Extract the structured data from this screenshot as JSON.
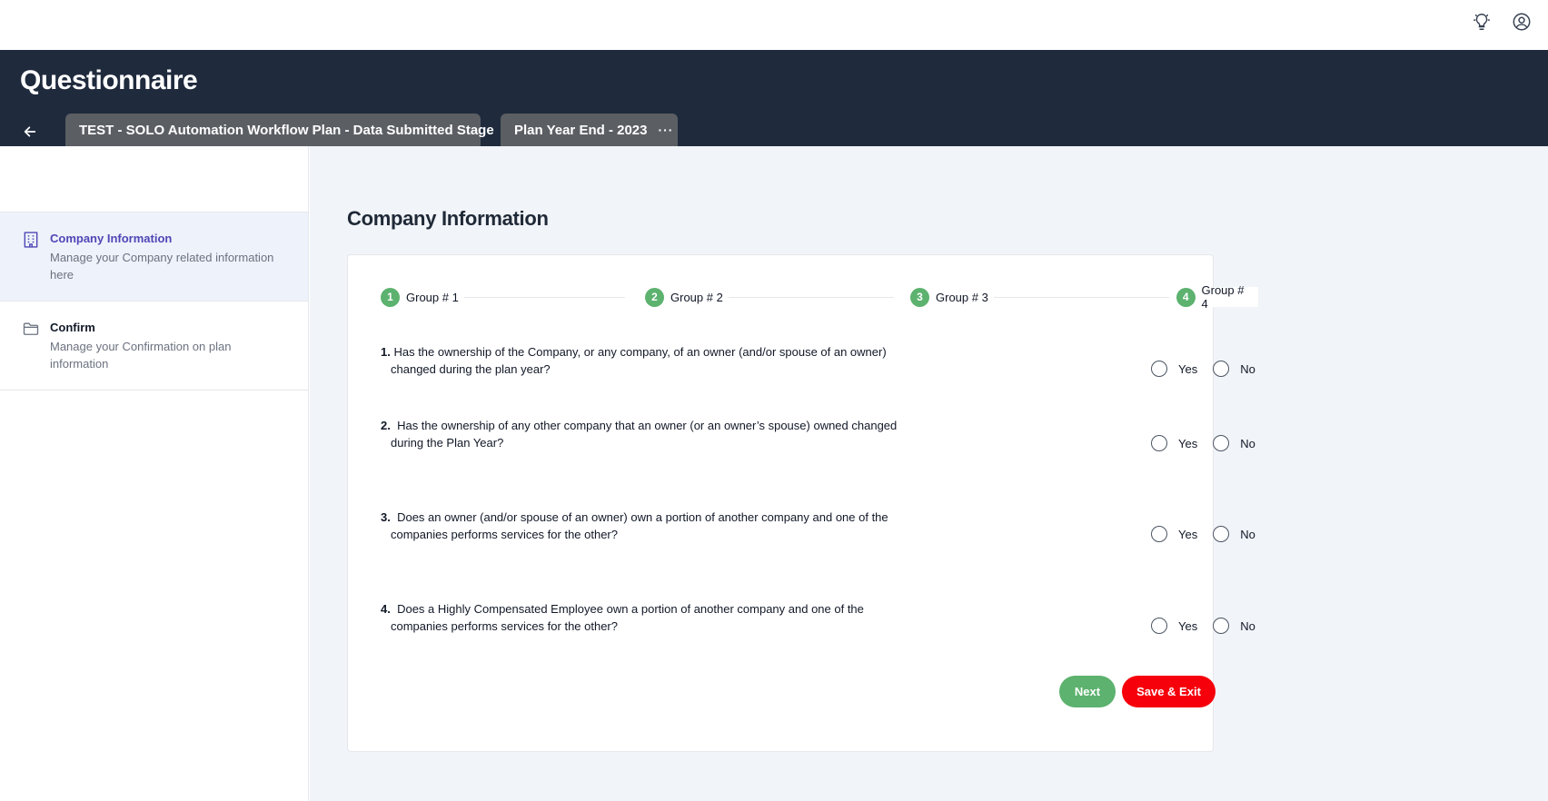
{
  "topbar": {
    "icons": [
      "lightbulb-icon",
      "user-circle-icon"
    ]
  },
  "header": {
    "title": "Questionnaire",
    "tabs": [
      {
        "label": "TEST - SOLO Automation Workflow Plan - Data Submitted Stage"
      },
      {
        "label": "Plan Year End - 2023",
        "more": "···"
      }
    ]
  },
  "sidebar": {
    "items": [
      {
        "title": "Company Information",
        "desc": "Manage your Company related information here",
        "icon": "building-icon",
        "active": true
      },
      {
        "title": "Confirm",
        "desc": "Manage your Confirmation on plan information",
        "icon": "folder-icon",
        "active": false
      }
    ]
  },
  "main": {
    "title": "Company Information",
    "steps": [
      {
        "num": "1",
        "label": "Group # 1"
      },
      {
        "num": "2",
        "label": "Group # 2"
      },
      {
        "num": "3",
        "label": "Group # 3"
      },
      {
        "num": "4",
        "label": "Group # 4"
      }
    ],
    "questions": [
      {
        "num": "1.",
        "text": "Has the ownership of the Company, or any company, of an owner (and/or spouse of an owner) changed during the plan year?"
      },
      {
        "num": "2.",
        "text": "Has the ownership of any other company that an owner (or an owner’s spouse) owned changed during the Plan Year?"
      },
      {
        "num": "3.",
        "text": "Does an owner (and/or spouse of an owner) own a portion of another company and one of the companies performs services for the other?"
      },
      {
        "num": "4.",
        "text": "Does a Highly Compensated Employee own a portion of another company and one of the companies performs services for the other?"
      }
    ],
    "options": {
      "yes": "Yes",
      "no": "No"
    },
    "buttons": {
      "next": "Next",
      "save_exit": "Save & Exit"
    }
  },
  "colors": {
    "header_bg": "#1f2a3d",
    "tab_bg": "#5b5e63",
    "step_green": "#5cb26e",
    "active_link": "#4f46b5",
    "save_red": "#f5000b"
  }
}
